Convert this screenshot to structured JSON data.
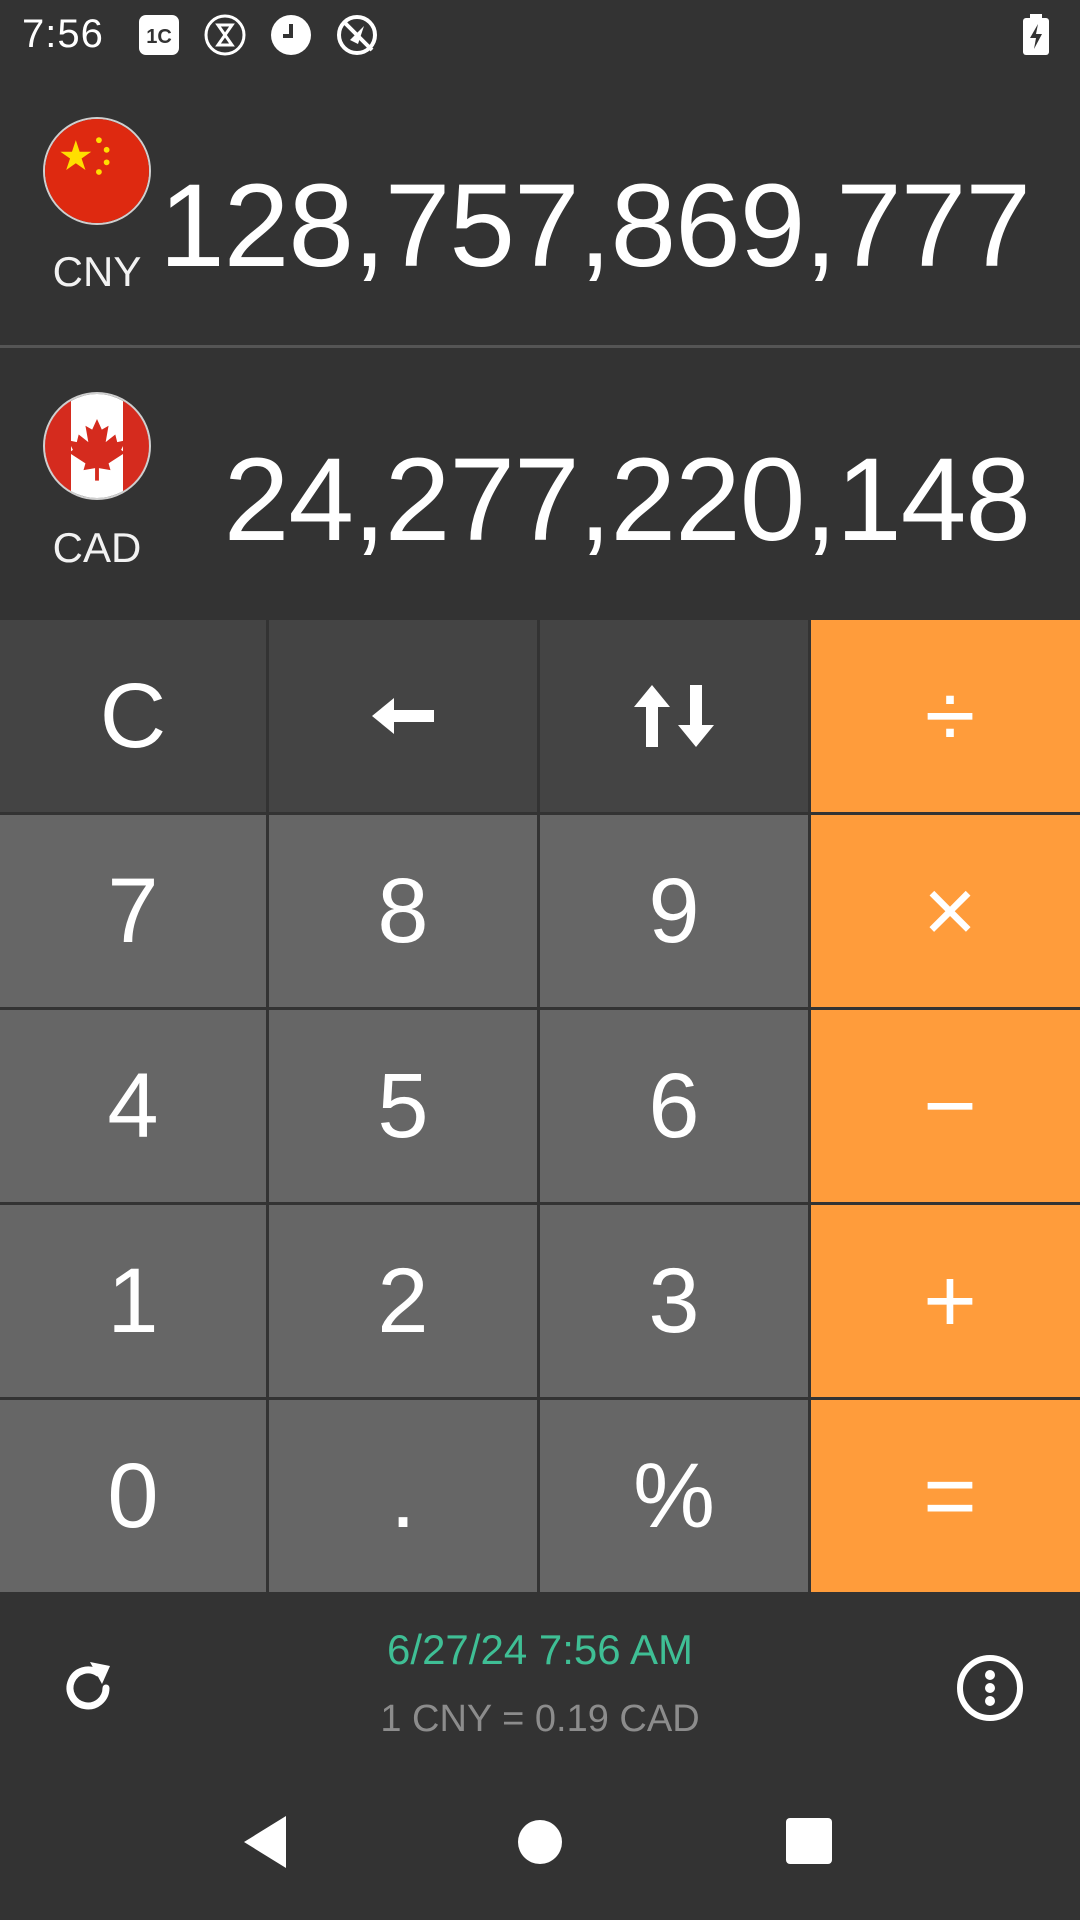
{
  "status_bar": {
    "time": "7:56",
    "icons": [
      "one-c-icon",
      "hourglass-icon",
      "clock-icon",
      "location-off-icon",
      "battery-charging-icon"
    ]
  },
  "from_currency": {
    "code": "CNY",
    "amount": "128,757,869,777",
    "flag": "china-flag-icon"
  },
  "to_currency": {
    "code": "CAD",
    "amount": "24,277,220,148",
    "flag": "canada-flag-icon"
  },
  "keypad": {
    "clear": "C",
    "backspace_icon": "backspace-arrow-icon",
    "swap_icon": "swap-arrows-icon",
    "divide": "÷",
    "multiply": "×",
    "minus": "−",
    "plus": "+",
    "equals": "=",
    "percent": "%",
    "dot": ".",
    "digits": {
      "d0": "0",
      "d1": "1",
      "d2": "2",
      "d3": "3",
      "d4": "4",
      "d5": "5",
      "d6": "6",
      "d7": "7",
      "d8": "8",
      "d9": "9"
    }
  },
  "footer": {
    "updated": "6/27/24 7:56 AM",
    "rate": "1 CNY = 0.19 CAD"
  },
  "colors": {
    "background": "#333333",
    "function_key": "#444444",
    "digit_key": "#666666",
    "operator_key": "#ff9c3b",
    "date_text": "#3fbf95"
  }
}
